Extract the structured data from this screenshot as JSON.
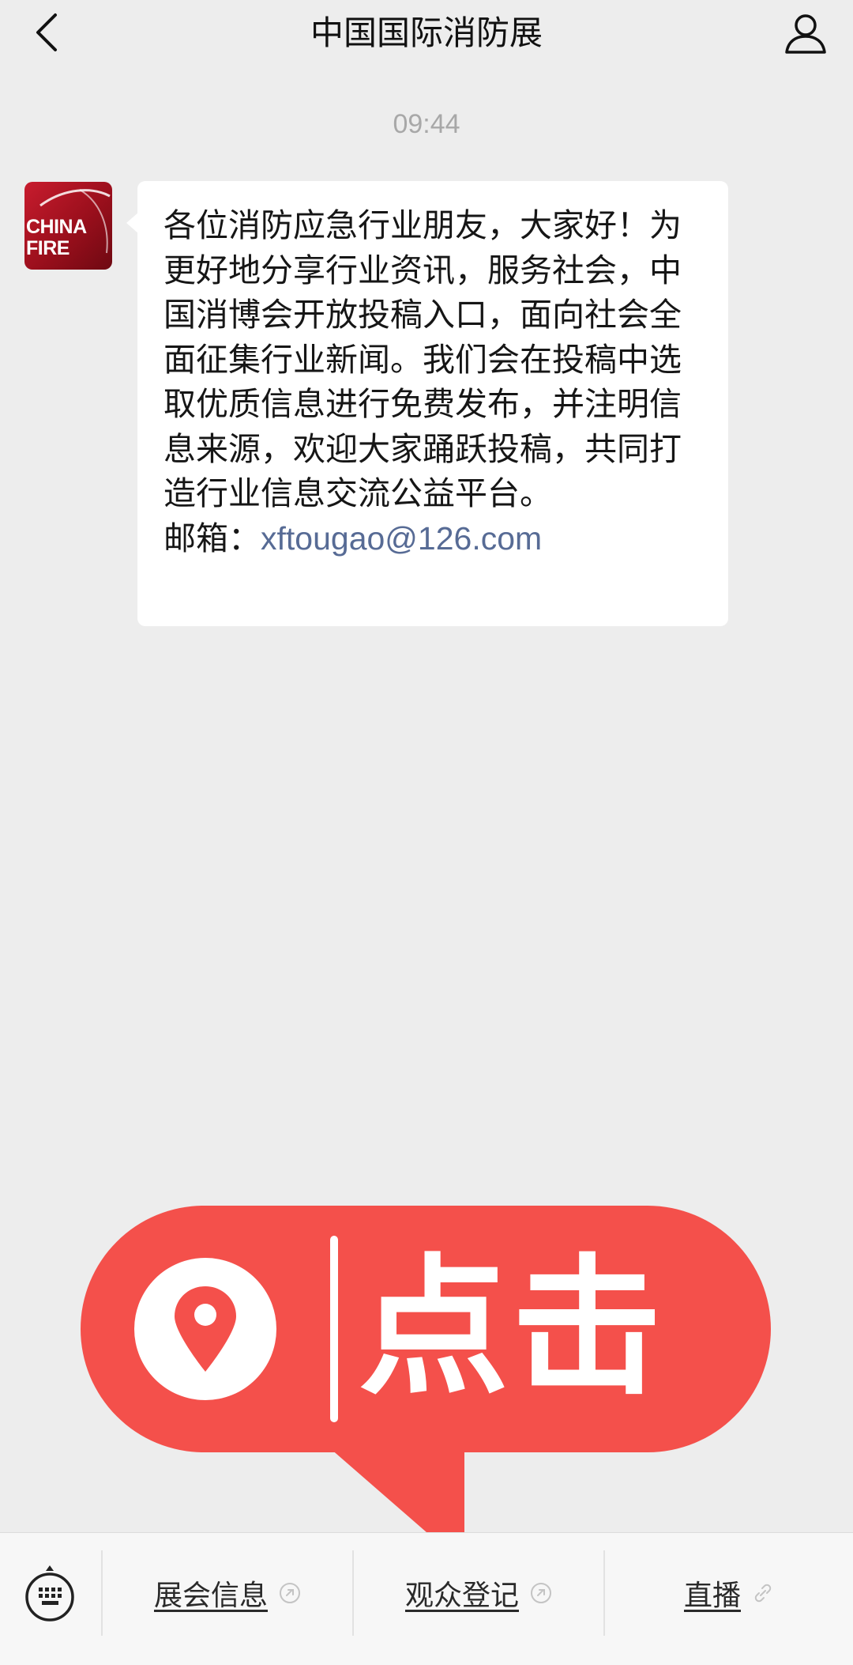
{
  "header": {
    "title": "中国国际消防展"
  },
  "chat": {
    "timestamp": "09:44",
    "avatar": {
      "line1": "CHINA",
      "line2": "FIRE"
    },
    "message": {
      "text": "各位消防应急行业朋友，大家好！为更好地分享行业资讯，服务社会，中国消博会开放投稿入口，面向社会全面征集行业新闻。我们会在投稿中选取优质信息进行免费发布，并注明信息来源，欢迎大家踊跃投稿，共同打造行业信息交流公益平台。",
      "email_label": "邮箱：",
      "email": "xftougao@126.com"
    }
  },
  "banner": {
    "text": "点击",
    "color": "#f4504b"
  },
  "bottom_menu": {
    "items": [
      {
        "label": "展会信息",
        "icon": "link-icon"
      },
      {
        "label": "观众登记",
        "icon": "link-icon"
      },
      {
        "label": "直播",
        "icon": "link-icon"
      }
    ]
  },
  "colors": {
    "background": "#ededed",
    "link": "#576b95",
    "bubble": "#ffffff"
  }
}
